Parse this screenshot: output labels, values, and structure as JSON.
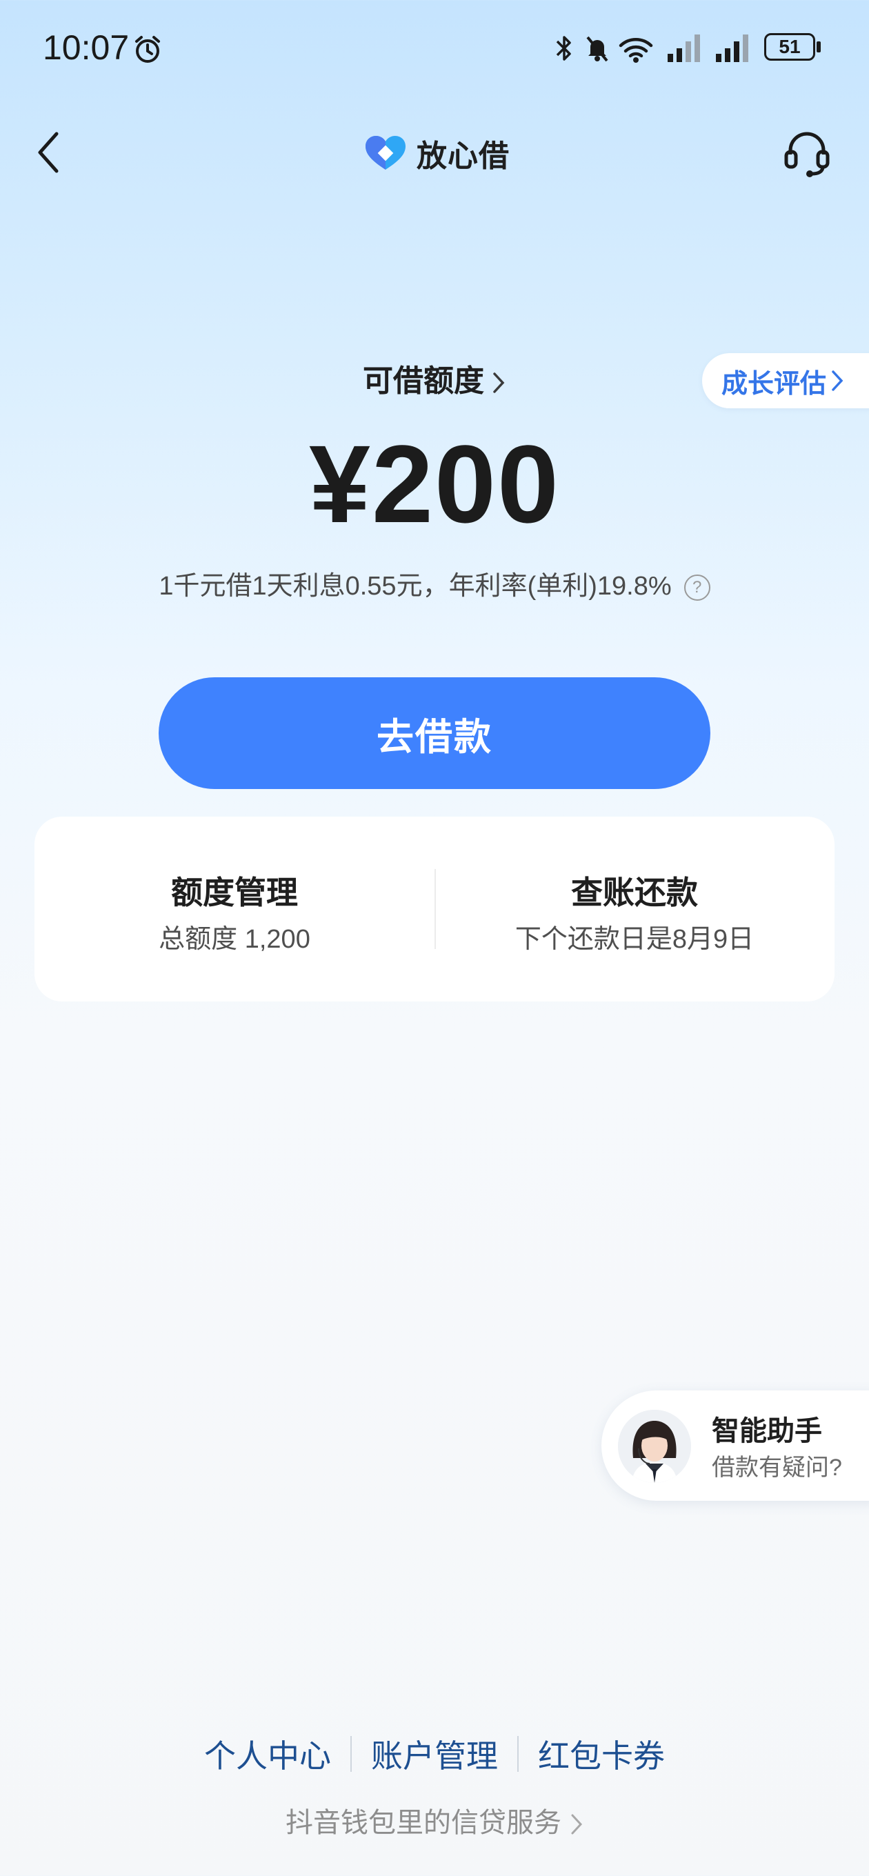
{
  "status_bar": {
    "time": "10:07",
    "battery": "51"
  },
  "header": {
    "brand_name": "放心借",
    "brand_color": "#2fa7f5"
  },
  "growth_pill": {
    "label": "成长评估"
  },
  "credit": {
    "label": "可借额度",
    "amount": "¥200",
    "rate_text": "1千元借1天利息0.55元，年利率(单利)19.8%",
    "help_glyph": "?"
  },
  "borrow_button": {
    "label": "去借款",
    "color": "#3f82fe"
  },
  "quick_card": {
    "left": {
      "title": "额度管理",
      "sub": "总额度 1,200"
    },
    "right": {
      "title": "查账还款",
      "sub": "下个还款日是8月9日"
    }
  },
  "assistant": {
    "title": "智能助手",
    "sub": "借款有疑问?"
  },
  "footer": {
    "links": [
      "个人中心",
      "账户管理",
      "红包卡券"
    ],
    "link_color": "#1d4f91",
    "sub": "抖音钱包里的信贷服务"
  }
}
